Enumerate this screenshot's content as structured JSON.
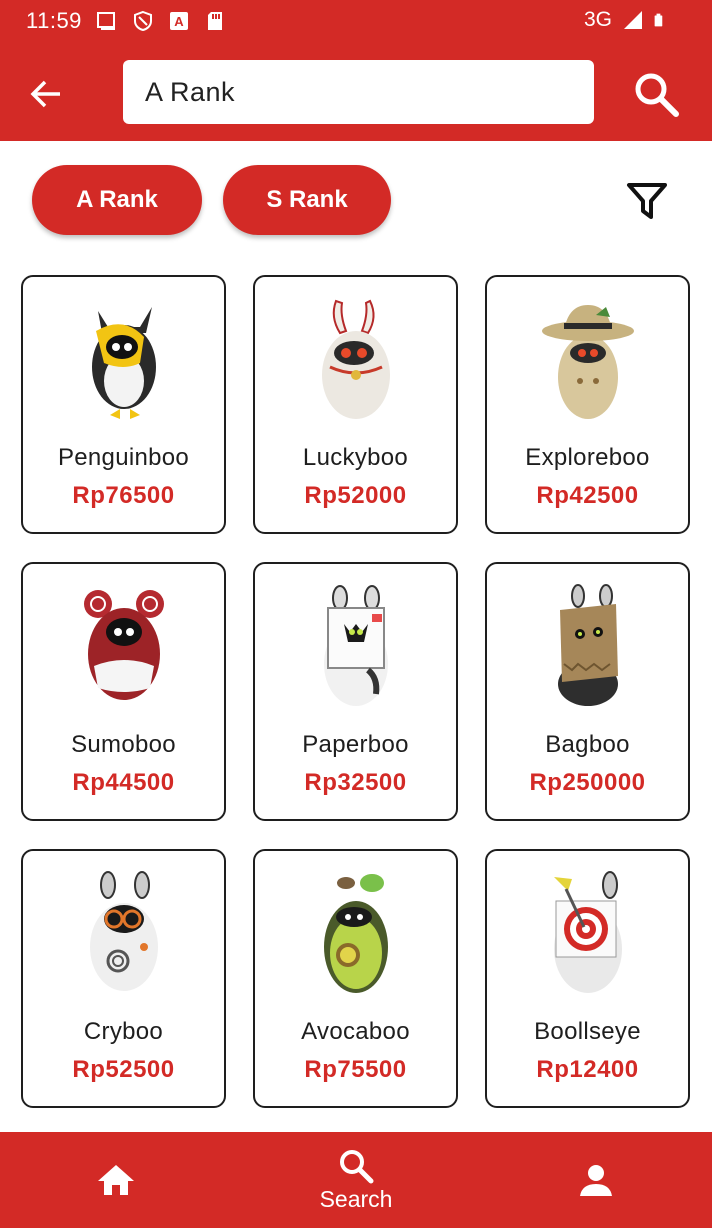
{
  "status_bar": {
    "time": "11:59",
    "network": "3G",
    "icons_left": [
      "screen-icon",
      "shield-icon",
      "a-badge-icon",
      "sd-card-icon"
    ],
    "icons_right": [
      "signal-icon",
      "battery-icon"
    ]
  },
  "app_bar": {
    "search_value": "A Rank",
    "back_icon": "arrow-left-icon",
    "search_icon": "search-icon"
  },
  "filters": {
    "chips": [
      {
        "label": "A Rank"
      },
      {
        "label": "S Rank"
      }
    ],
    "filter_icon": "funnel-icon"
  },
  "items": [
    {
      "name": "Penguinboo",
      "price": "Rp76500"
    },
    {
      "name": "Luckyboo",
      "price": "Rp52000"
    },
    {
      "name": "Exploreboo",
      "price": "Rp42500"
    },
    {
      "name": "Sumoboo",
      "price": "Rp44500"
    },
    {
      "name": "Paperboo",
      "price": "Rp32500"
    },
    {
      "name": "Bagboo",
      "price": "Rp250000"
    },
    {
      "name": "Cryboo",
      "price": "Rp52500"
    },
    {
      "name": "Avocaboo",
      "price": "Rp75500"
    },
    {
      "name": "Boollseye",
      "price": "Rp12400"
    }
  ],
  "bottom_nav": {
    "home_icon": "home-icon",
    "search_label": "Search",
    "profile_icon": "person-icon"
  },
  "colors": {
    "accent": "#d32a26",
    "card_border": "#1e1e1e",
    "price": "#d32a26"
  }
}
